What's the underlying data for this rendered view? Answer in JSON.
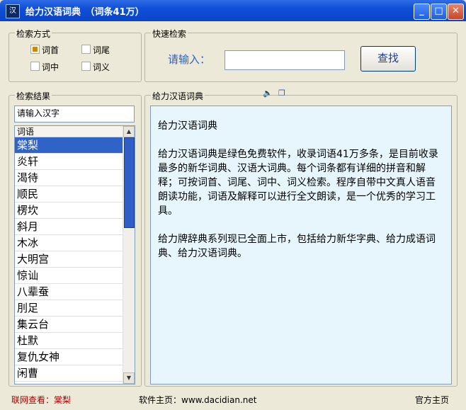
{
  "window": {
    "title": "给力汉语词典　（词条41万）",
    "icon_label": "汉"
  },
  "search_mode": {
    "label": "检索方式",
    "options": [
      {
        "label": "词首",
        "checked": true
      },
      {
        "label": "词尾",
        "checked": false
      },
      {
        "label": "词中",
        "checked": false
      },
      {
        "label": "词义",
        "checked": false
      }
    ]
  },
  "quick_search": {
    "label": "快速检索",
    "prompt": "请输入：",
    "value": "",
    "button": "查找"
  },
  "results": {
    "label": "检索结果",
    "input_value": "请输入汉字",
    "column": "词语",
    "items": [
      "棠梨",
      "炎轩",
      "渴待",
      "顺民",
      "楞坎",
      "斜月",
      "木冰",
      "大明宫",
      "惊讪",
      "八辈蚕",
      "刖足",
      "集云台",
      "杜默",
      "复仇女神",
      "闲曹"
    ],
    "selected_index": 0
  },
  "dictionary": {
    "label": "给力汉语词典",
    "heading": "给力汉语词典",
    "paragraphs": [
      "给力汉语词典是绿色免费软件，收录词语41万多条，是目前收录最多的新华词典、汉语大词典。每个词条都有详细的拼音和解释；可按词首、词尾、词中、词义检索。程序自带中文真人语音朗读功能，词语及解释可以进行全文朗读，是一个优秀的学习工具。",
      "给力牌辞典系列现已全面上市，包括给力新华字典、给力成语词典、给力汉语词典。"
    ]
  },
  "status": {
    "lookup": "联网查看：棠梨",
    "homepage": "软件主页：www.dacidian.net",
    "official": "官方主页"
  }
}
